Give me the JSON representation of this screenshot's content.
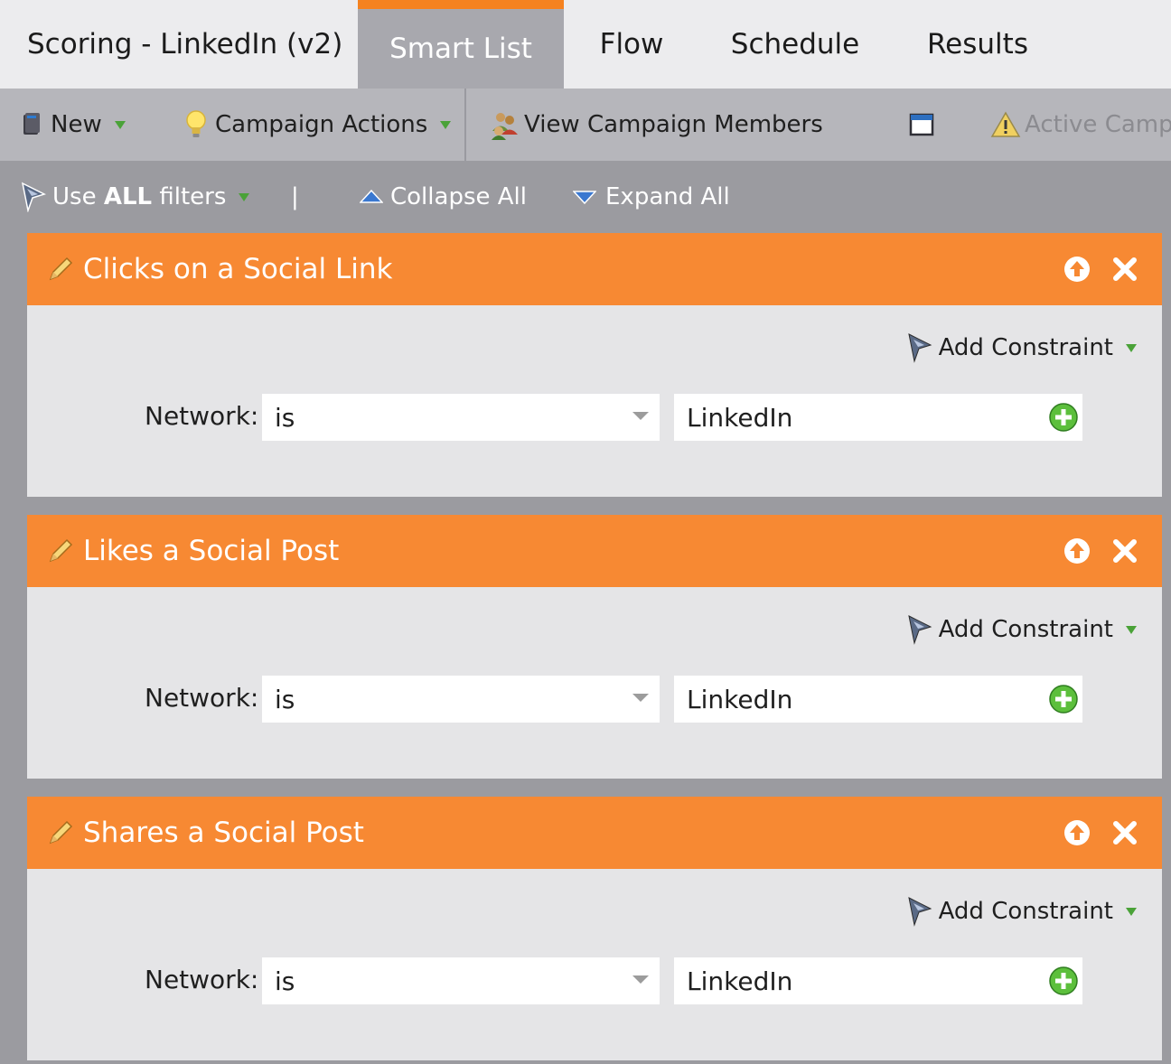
{
  "tabs": {
    "title": "Scoring - LinkedIn (v2)",
    "smart_list": "Smart List",
    "flow": "Flow",
    "schedule": "Schedule",
    "results": "Results"
  },
  "toolbar": {
    "new": "New",
    "campaign_actions": "Campaign Actions",
    "view_members": "View Campaign Members",
    "active_campaign": "Active Campa"
  },
  "filterbar": {
    "use_prefix": "Use ",
    "use_all": "ALL",
    "use_suffix": " filters",
    "divider": "|",
    "collapse_all": "Collapse All",
    "expand_all": "Expand All"
  },
  "filters": [
    {
      "title": "Clicks on a Social Link",
      "add_constraint": "Add Constraint",
      "field_label": "Network:",
      "operator": "is",
      "value": "LinkedIn"
    },
    {
      "title": "Likes a Social Post",
      "add_constraint": "Add Constraint",
      "field_label": "Network:",
      "operator": "is",
      "value": "LinkedIn"
    },
    {
      "title": "Shares a Social Post",
      "add_constraint": "Add Constraint",
      "field_label": "Network:",
      "operator": "is",
      "value": "LinkedIn"
    }
  ],
  "colors": {
    "accent_orange": "#f78933",
    "active_tab": "#a8a8ae",
    "dropdown_caret_green": "#4aa238"
  },
  "icons": {
    "new": "new-document-icon",
    "campaign_actions": "lightbulb-icon",
    "view_members": "people-icon",
    "window": "window-icon",
    "warning": "warning-icon",
    "filter": "funnel-icon",
    "collapse": "collapse-triangle-icon",
    "expand": "expand-triangle-icon",
    "filter_edit": "pencil-icon",
    "move_up": "arrow-up-circle-icon",
    "remove": "close-icon",
    "add_value": "plus-circle-icon"
  }
}
